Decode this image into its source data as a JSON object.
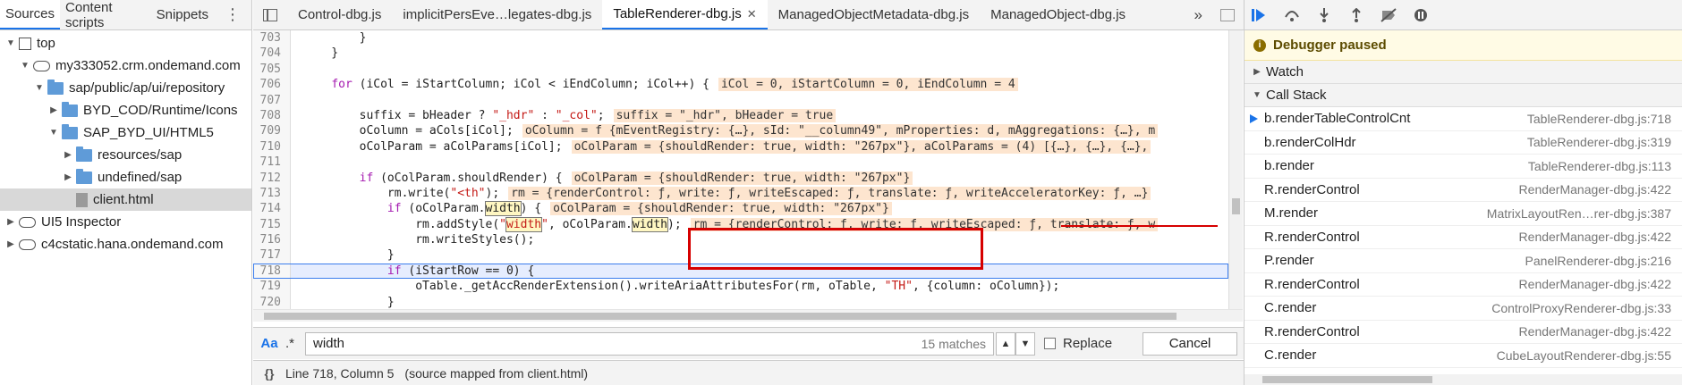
{
  "left": {
    "tabs": [
      "Sources",
      "Content scripts",
      "Snippets"
    ],
    "more_label": "⋮",
    "tree": [
      {
        "label": "top",
        "indent": 0,
        "icon": "square",
        "open": true
      },
      {
        "label": "my333052.crm.ondemand.com",
        "indent": 1,
        "icon": "cloud",
        "open": true
      },
      {
        "label": "sap/public/ap/ui/repository",
        "indent": 2,
        "icon": "folder",
        "open": true
      },
      {
        "label": "BYD_COD/Runtime/Icons",
        "indent": 3,
        "icon": "folder",
        "open": false
      },
      {
        "label": "SAP_BYD_UI/HTML5",
        "indent": 3,
        "icon": "folder",
        "open": true
      },
      {
        "label": "resources/sap",
        "indent": 4,
        "icon": "folder",
        "open": false
      },
      {
        "label": "undefined/sap",
        "indent": 4,
        "icon": "folder",
        "open": false
      },
      {
        "label": "client.html",
        "indent": 4,
        "icon": "file",
        "selected": true
      },
      {
        "label": "UI5 Inspector",
        "indent": 0,
        "icon": "cloud",
        "open": false
      },
      {
        "label": "c4cstatic.hana.ondemand.com",
        "indent": 0,
        "icon": "cloud",
        "open": false
      }
    ]
  },
  "editor": {
    "tabs": [
      {
        "label": "Control-dbg.js",
        "active": false
      },
      {
        "label": "implicitPersEve…legates-dbg.js",
        "active": false
      },
      {
        "label": "TableRenderer-dbg.js",
        "active": true
      },
      {
        "label": "ManagedObjectMetadata-dbg.js",
        "active": false
      },
      {
        "label": "ManagedObject-dbg.js",
        "active": false
      }
    ],
    "overflow": "»",
    "lines": [
      {
        "n": "703",
        "code": "        }"
      },
      {
        "n": "704",
        "code": "    }"
      },
      {
        "n": "705",
        "code": ""
      },
      {
        "n": "706",
        "code": "    for (iCol = iStartColumn; iCol < iEndColumn; iCol++) {",
        "inline": "iCol = 0, iStartColumn = 0, iEndColumn = 4"
      },
      {
        "n": "707",
        "code": ""
      },
      {
        "n": "708",
        "code": "        suffix = bHeader ? \"_hdr\" : \"_col\";",
        "inline": "suffix = \"_hdr\", bHeader = true"
      },
      {
        "n": "709",
        "code": "        oColumn = aCols[iCol];",
        "inline": "oColumn = f {mEventRegistry: {…}, sId: \"__column49\", mProperties: d, mAggregations: {…}, m"
      },
      {
        "n": "710",
        "code": "        oColParam = aColParams[iCol];",
        "inline": "oColParam = {shouldRender: true, width: \"267px\"}, aColParams = (4) [{…}, {…}, {…},"
      },
      {
        "n": "711",
        "code": ""
      },
      {
        "n": "712",
        "code": "        if (oColParam.shouldRender) {",
        "inline": "oColParam = {shouldRender: true, width: \"267px\"}"
      },
      {
        "n": "713",
        "code": "            rm.write(\"<th\");",
        "inline": "rm = {renderControl: ƒ, write: ƒ, writeEscaped: ƒ, translate: ƒ, writeAcceleratorKey: ƒ, …}"
      },
      {
        "n": "714",
        "code": "            if (oColParam.width) {",
        "inline": "oColParam = {shouldRender: true, width: \"267px\"}"
      },
      {
        "n": "715",
        "code": "                rm.addStyle(\"width\", oColParam.width);",
        "inline": "rm = {renderControl: ƒ, write: ƒ, writeEscaped: ƒ, translate: ƒ, w"
      },
      {
        "n": "716",
        "code": "                rm.writeStyles();"
      },
      {
        "n": "717",
        "code": "            }"
      },
      {
        "n": "718",
        "code": "            if (iStartRow == 0) {",
        "exec": true
      },
      {
        "n": "719",
        "code": "                oTable._getAccRenderExtension().writeAriaAttributesFor(rm, oTable, \"TH\", {column: oColumn});"
      },
      {
        "n": "720",
        "code": "            }"
      }
    ],
    "search": {
      "case_label": "Aa",
      "regex_label": ".*",
      "query": "width",
      "matches": "15 matches",
      "replace_label": "Replace",
      "cancel_label": "Cancel"
    },
    "status": {
      "braces": "{}",
      "position": "Line 718, Column 5",
      "mapped": "(source mapped from client.html)"
    }
  },
  "debugger": {
    "paused_label": "Debugger paused",
    "watch_label": "Watch",
    "callstack_label": "Call Stack",
    "frames": [
      {
        "fn": "b.renderTableControlCnt",
        "loc": "TableRenderer-dbg.js:718",
        "current": true
      },
      {
        "fn": "b.renderColHdr",
        "loc": "TableRenderer-dbg.js:319"
      },
      {
        "fn": "b.render",
        "loc": "TableRenderer-dbg.js:113"
      },
      {
        "fn": "R.renderControl",
        "loc": "RenderManager-dbg.js:422"
      },
      {
        "fn": "M.render",
        "loc": "MatrixLayoutRen…rer-dbg.js:387"
      },
      {
        "fn": "R.renderControl",
        "loc": "RenderManager-dbg.js:422"
      },
      {
        "fn": "P.render",
        "loc": "PanelRenderer-dbg.js:216"
      },
      {
        "fn": "R.renderControl",
        "loc": "RenderManager-dbg.js:422"
      },
      {
        "fn": "C.render",
        "loc": "ControlProxyRenderer-dbg.js:33"
      },
      {
        "fn": "R.renderControl",
        "loc": "RenderManager-dbg.js:422"
      },
      {
        "fn": "C.render",
        "loc": "CubeLayoutRenderer-dbg.js:55"
      }
    ]
  }
}
